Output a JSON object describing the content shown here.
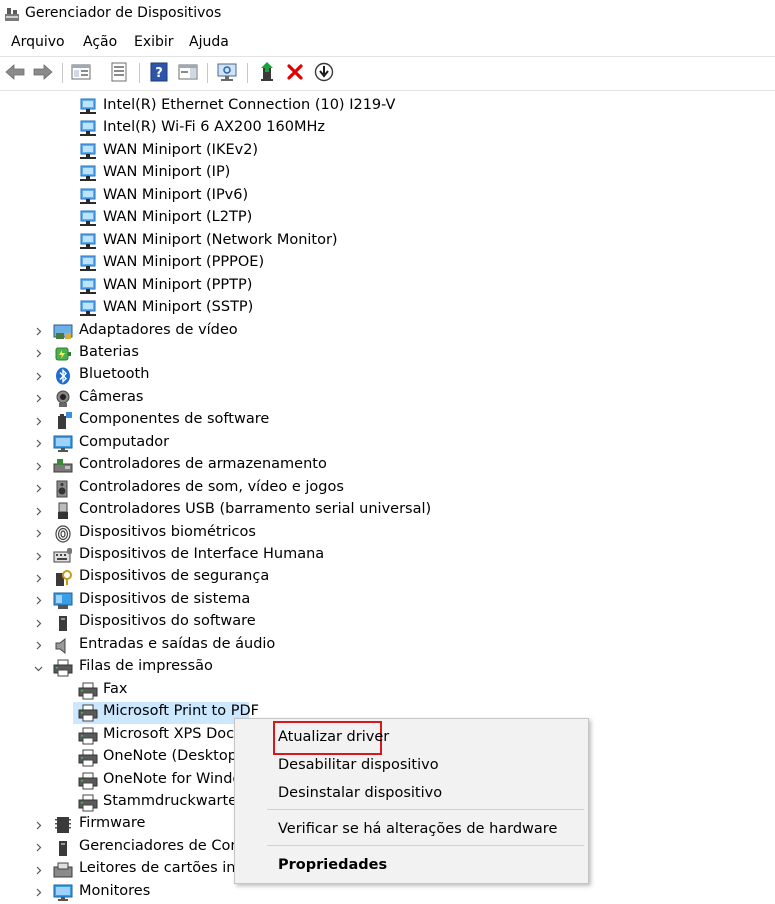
{
  "window": {
    "title": "Gerenciador de Dispositivos"
  },
  "menu": [
    "Arquivo",
    "Ação",
    "Exibir",
    "Ajuda"
  ],
  "toolbar": {
    "buttons": [
      "back-icon",
      "forward-icon",
      "show-hide-console-tree-icon",
      "properties-icon",
      "help-icon",
      "action-pane-icon",
      "scan-hardware-icon",
      "update-driver-icon",
      "uninstall-device-icon",
      "disable-device-icon"
    ],
    "colors": {
      "uninstall": "#e00000",
      "accent": "#1f6fd1"
    }
  },
  "tree": {
    "network_children": [
      "Intel(R) Ethernet Connection (10) I219-V",
      "Intel(R) Wi-Fi 6 AX200 160MHz",
      "WAN Miniport (IKEv2)",
      "WAN Miniport (IP)",
      "WAN Miniport (IPv6)",
      "WAN Miniport (L2TP)",
      "WAN Miniport (Network Monitor)",
      "WAN Miniport (PPPOE)",
      "WAN Miniport (PPTP)",
      "WAN Miniport (SSTP)"
    ],
    "categories_a": [
      {
        "label": "Adaptadores de vídeo",
        "icon": "display-adapter-icon"
      },
      {
        "label": "Baterias",
        "icon": "battery-icon"
      },
      {
        "label": "Bluetooth",
        "icon": "bluetooth-icon"
      },
      {
        "label": "Câmeras",
        "icon": "camera-icon"
      },
      {
        "label": "Componentes de software",
        "icon": "software-component-icon"
      },
      {
        "label": "Computador",
        "icon": "computer-icon"
      },
      {
        "label": "Controladores de armazenamento",
        "icon": "storage-controller-icon"
      },
      {
        "label": "Controladores de som, vídeo e jogos",
        "icon": "speaker-icon"
      },
      {
        "label": "Controladores USB (barramento serial universal)",
        "icon": "usb-icon"
      },
      {
        "label": "Dispositivos biométricos",
        "icon": "fingerprint-icon"
      },
      {
        "label": "Dispositivos de Interface Humana",
        "icon": "hid-icon"
      },
      {
        "label": "Dispositivos de segurança",
        "icon": "security-device-icon"
      },
      {
        "label": "Dispositivos de sistema",
        "icon": "system-device-icon"
      },
      {
        "label": "Dispositivos do software",
        "icon": "software-device-icon"
      },
      {
        "label": "Entradas e saídas de áudio",
        "icon": "audio-io-icon"
      }
    ],
    "print_queues": {
      "label": "Filas de impressão",
      "children": [
        "Fax",
        "Microsoft Print to PDF",
        "Microsoft XPS Docur",
        "OneNote (Desktop)",
        "OneNote for Windo",
        "Stammdruckwartesch"
      ],
      "selected": "Microsoft Print to PDF"
    },
    "categories_b": [
      {
        "label": "Firmware",
        "icon": "firmware-icon"
      },
      {
        "label": "Gerenciadores de Conec",
        "icon": "connection-manager-icon"
      },
      {
        "label": "Leitores de cartões intel",
        "icon": "card-reader-icon"
      },
      {
        "label": "Monitores",
        "icon": "monitor-icon"
      }
    ]
  },
  "context_menu": {
    "update": "Atualizar driver",
    "disable": "Desabilitar dispositivo",
    "uninstall": "Desinstalar dispositivo",
    "scan": "Verificar se há alterações de hardware",
    "properties": "Propriedades",
    "highlight_color": "#d7191c"
  },
  "colors": {
    "selection": "#cce8ff",
    "network_icon": "#1e88e5"
  }
}
